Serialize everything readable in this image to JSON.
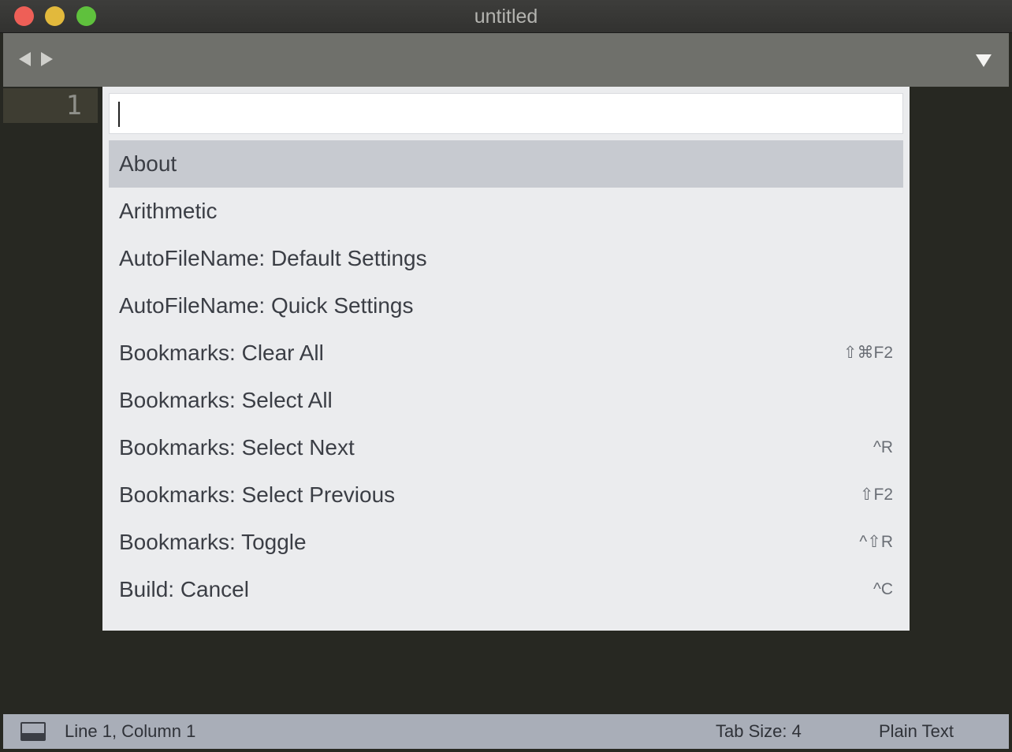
{
  "window": {
    "title": "untitled"
  },
  "tabbar": {
    "back_icon": "triangle-left",
    "forward_icon": "triangle-right",
    "menu_icon": "triangle-down"
  },
  "editor": {
    "line_numbers": [
      "1"
    ]
  },
  "palette": {
    "input_value": "",
    "items": [
      {
        "label": "About",
        "shortcut": "",
        "selected": true
      },
      {
        "label": "Arithmetic",
        "shortcut": ""
      },
      {
        "label": "AutoFileName: Default Settings",
        "shortcut": ""
      },
      {
        "label": "AutoFileName: Quick Settings",
        "shortcut": ""
      },
      {
        "label": "Bookmarks: Clear All",
        "shortcut": "⇧⌘F2"
      },
      {
        "label": "Bookmarks: Select All",
        "shortcut": ""
      },
      {
        "label": "Bookmarks: Select Next",
        "shortcut": "^R"
      },
      {
        "label": "Bookmarks: Select Previous",
        "shortcut": "⇧F2"
      },
      {
        "label": "Bookmarks: Toggle",
        "shortcut": "^⇧R"
      },
      {
        "label": "Build: Cancel",
        "shortcut": "^C"
      }
    ]
  },
  "statusbar": {
    "position": "Line 1, Column 1",
    "tab_size": "Tab Size: 4",
    "syntax": "Plain Text"
  },
  "colors": {
    "close": "#ee5f57",
    "minimize": "#e2b93c",
    "maximize": "#5fc13d",
    "editor_bg": "#272822",
    "palette_bg": "#ebecee",
    "selected_item": "#c7cad0"
  }
}
